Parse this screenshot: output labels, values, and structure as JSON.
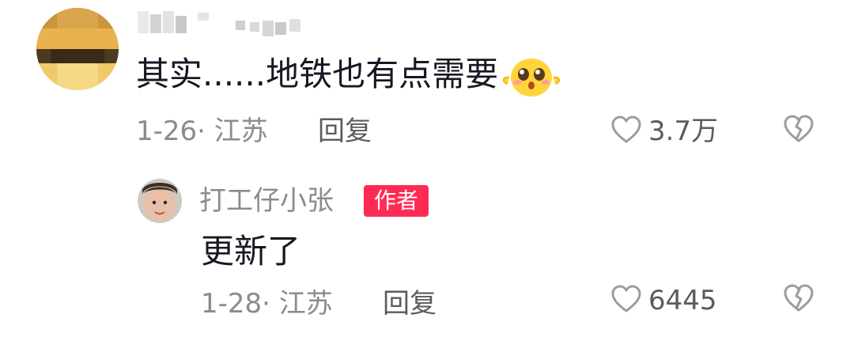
{
  "main_comment": {
    "text": "其实......地铁也有点需要",
    "emoji": "pleading-face-emoji",
    "date_location": "1-26· 江苏",
    "reply_label": "回复",
    "like_count": "3.7万"
  },
  "reply_comment": {
    "username": "打工仔小张",
    "badge": "作者",
    "text": "更新了",
    "date_location": "1-28· 江苏",
    "reply_label": "回复",
    "like_count": "6445"
  },
  "colors": {
    "primary_text": "#161823",
    "secondary_text": "#8a8b91",
    "badge_bg": "#fe2c55",
    "icon": "#9b9ca1"
  },
  "icons": {
    "like": "heart-outline-icon",
    "dislike": "broken-heart-icon"
  }
}
